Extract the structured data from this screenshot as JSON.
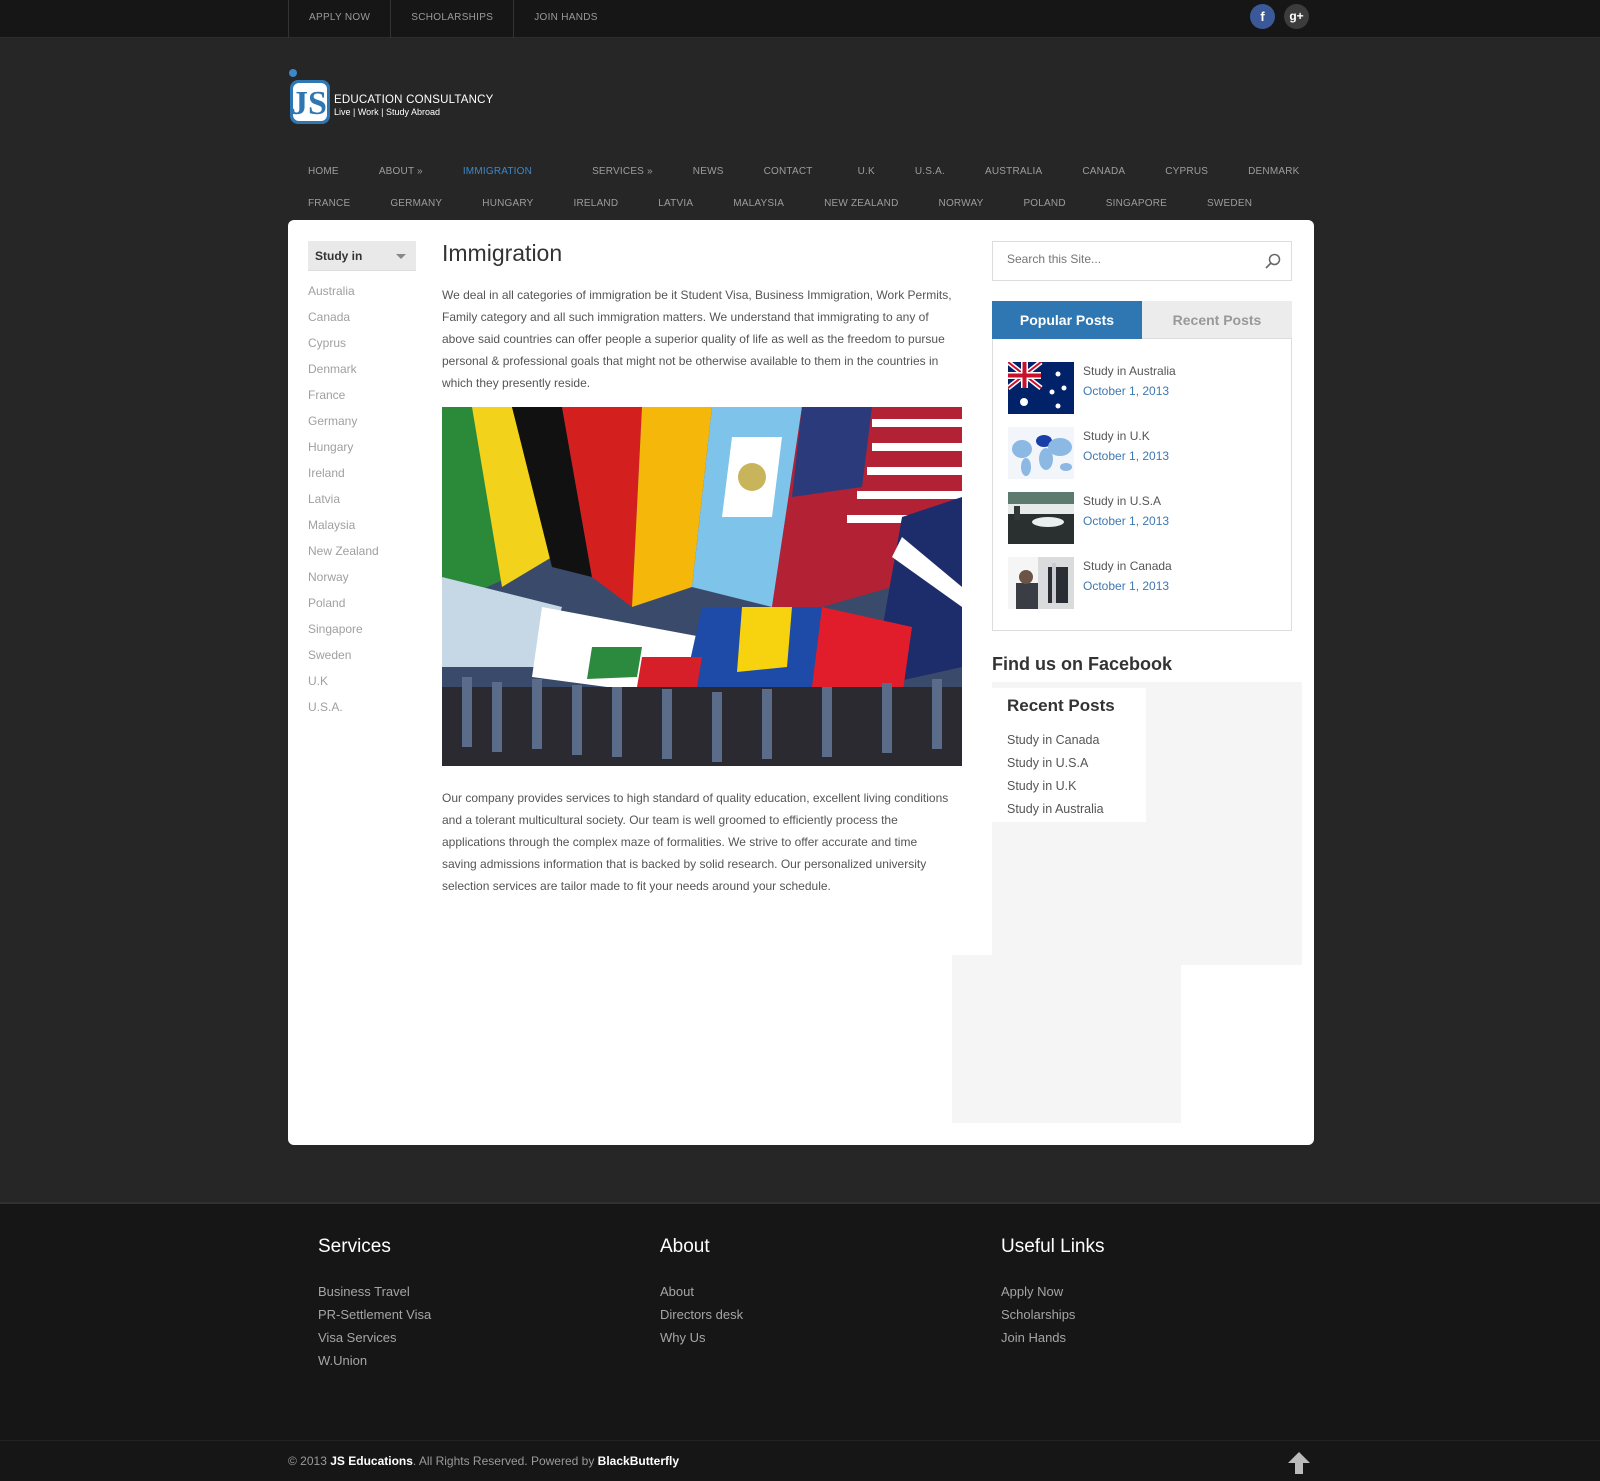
{
  "topbar": {
    "links": [
      "APPLY NOW",
      "SCHOLARSHIPS",
      "JOIN HANDS"
    ],
    "social": {
      "facebook": "f",
      "googleplus": "g+"
    }
  },
  "logo": {
    "line1": "EDUCATION CONSULTANCY",
    "line2": "Live | Work | Study Abroad"
  },
  "nav": {
    "row1": [
      "HOME",
      "ABOUT »",
      "IMMIGRATION",
      "SERVICES »",
      "NEWS",
      "CONTACT",
      "U.K",
      "U.S.A.",
      "AUSTRALIA",
      "CANADA",
      "CYPRUS",
      "DENMARK"
    ],
    "row2": [
      "FRANCE",
      "GERMANY",
      "HUNGARY",
      "IRELAND",
      "LATVIA",
      "MALAYSIA",
      "NEW ZEALAND",
      "NORWAY",
      "POLAND",
      "SINGAPORE",
      "SWEDEN"
    ],
    "active": "IMMIGRATION",
    "active_color": "#3e87c7"
  },
  "left": {
    "dropdown_label": "Study in",
    "countries": [
      "Australia",
      "Canada",
      "Cyprus",
      "Denmark",
      "France",
      "Germany",
      "Hungary",
      "Ireland",
      "Latvia",
      "Malaysia",
      "New Zealand",
      "Norway",
      "Poland",
      "Singapore",
      "Sweden",
      "U.K",
      "U.S.A."
    ]
  },
  "main": {
    "title": "Immigration",
    "para1": "We deal in all categories of immigration be it Student Visa, Business Immigration, Work Permits, Family category and all such immigration matters. We understand that immigrating to any of above said countries can offer people a superior quality of life as well as the freedom to pursue personal & professional goals that might not be otherwise available to them in the countries in which they presently reside.",
    "para2": "Our company provides services to high standard of quality education, excellent living conditions and a tolerant multicultural society. Our team is well groomed to efficiently process the applications through the complex maze of formalities. We strive to offer accurate and time saving admissions information that is backed by solid research. Our personalized university selection services are tailor made to fit your needs around your schedule."
  },
  "right": {
    "search_placeholder": "Search this Site...",
    "tab_popular": "Popular Posts",
    "tab_recent": "Recent Posts",
    "posts": [
      {
        "title": "Study in Australia",
        "date": "October 1, 2013"
      },
      {
        "title": "Study in U.K",
        "date": "October 1, 2013"
      },
      {
        "title": "Study in U.S.A",
        "date": "October 1, 2013"
      },
      {
        "title": "Study in Canada",
        "date": "October 1, 2013"
      }
    ],
    "facebook_title": "Find us on Facebook",
    "recent_title": "Recent Posts",
    "recent_posts": [
      "Study in Canada",
      "Study in U.S.A",
      "Study in U.K",
      "Study in Australia"
    ]
  },
  "footer": {
    "services": {
      "title": "Services",
      "items": [
        "Business Travel",
        "PR-Settlement Visa",
        "Visa Services",
        "W.Union"
      ]
    },
    "about": {
      "title": "About",
      "items": [
        "About",
        "Directors desk",
        "Why Us"
      ]
    },
    "links": {
      "title": "Useful Links",
      "items": [
        "Apply Now",
        "Scholarships",
        "Join Hands"
      ]
    },
    "copy_prefix": "© 2013",
    "copy_brand": "JS Educations",
    "copy_mid": ". All Rights Reserved. Powered by",
    "copy_powered": "BlackButterfly"
  }
}
